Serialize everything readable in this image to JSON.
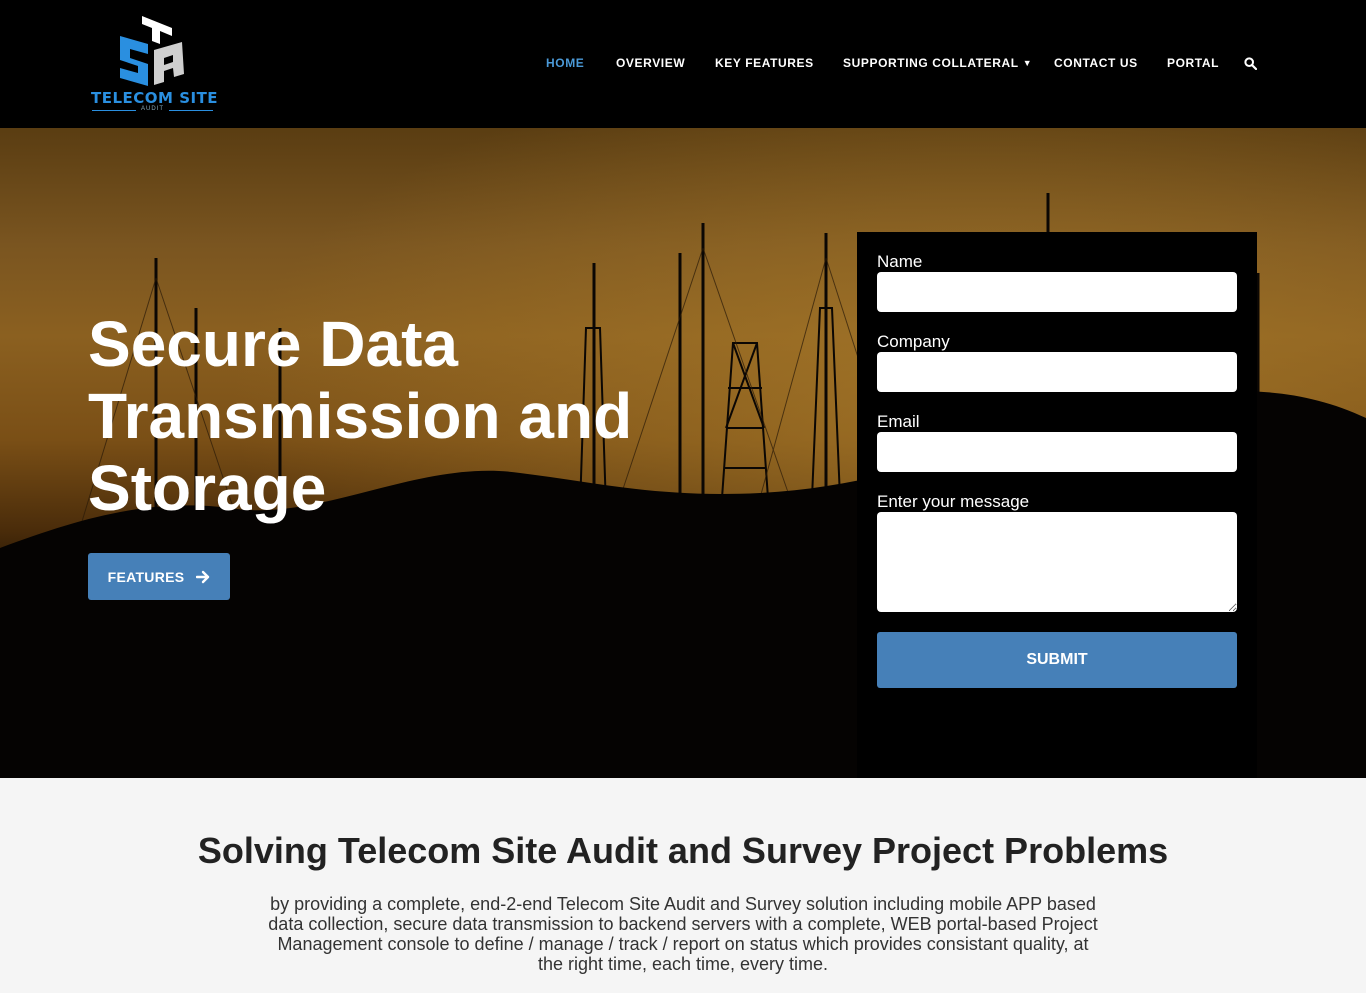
{
  "header": {
    "logo_text": "TELECOM SITE",
    "logo_sub": "AUDIT",
    "logo_mark": "TSA",
    "colors": {
      "brand": "#2a8fe0",
      "background": "#000000"
    }
  },
  "nav": {
    "items": [
      {
        "label": "HOME",
        "active": true
      },
      {
        "label": "OVERVIEW"
      },
      {
        "label": "KEY FEATURES"
      },
      {
        "label": "SUPPORTING COLLATERAL"
      },
      {
        "label": "CONTACT US"
      },
      {
        "label": "PORTAL"
      }
    ],
    "search_icon": "search-icon",
    "dropdown_icon": "chevron-down-icon",
    "active_color": "#4b9ad8"
  },
  "hero": {
    "title": "Secure Data Transmission and Storage",
    "button_label": "FEATURES",
    "button_icon": "arrow-right-icon",
    "button_color": "#4680b8"
  },
  "form": {
    "name_label": "Name",
    "company_label": "Company",
    "email_label": "Email",
    "message_label": "Enter your message",
    "submit_label": "SUBMIT"
  },
  "section": {
    "title": "Solving Telecom Site Audit and Survey Project Problems",
    "text": "by providing a complete, end-2-end Telecom Site Audit and Survey solution including mobile APP based data collection, secure data transmission to backend servers with a complete, WEB portal-based Project Management console to define / manage / track / report on status which provides consistant quality, at the right time, each time, every time."
  }
}
